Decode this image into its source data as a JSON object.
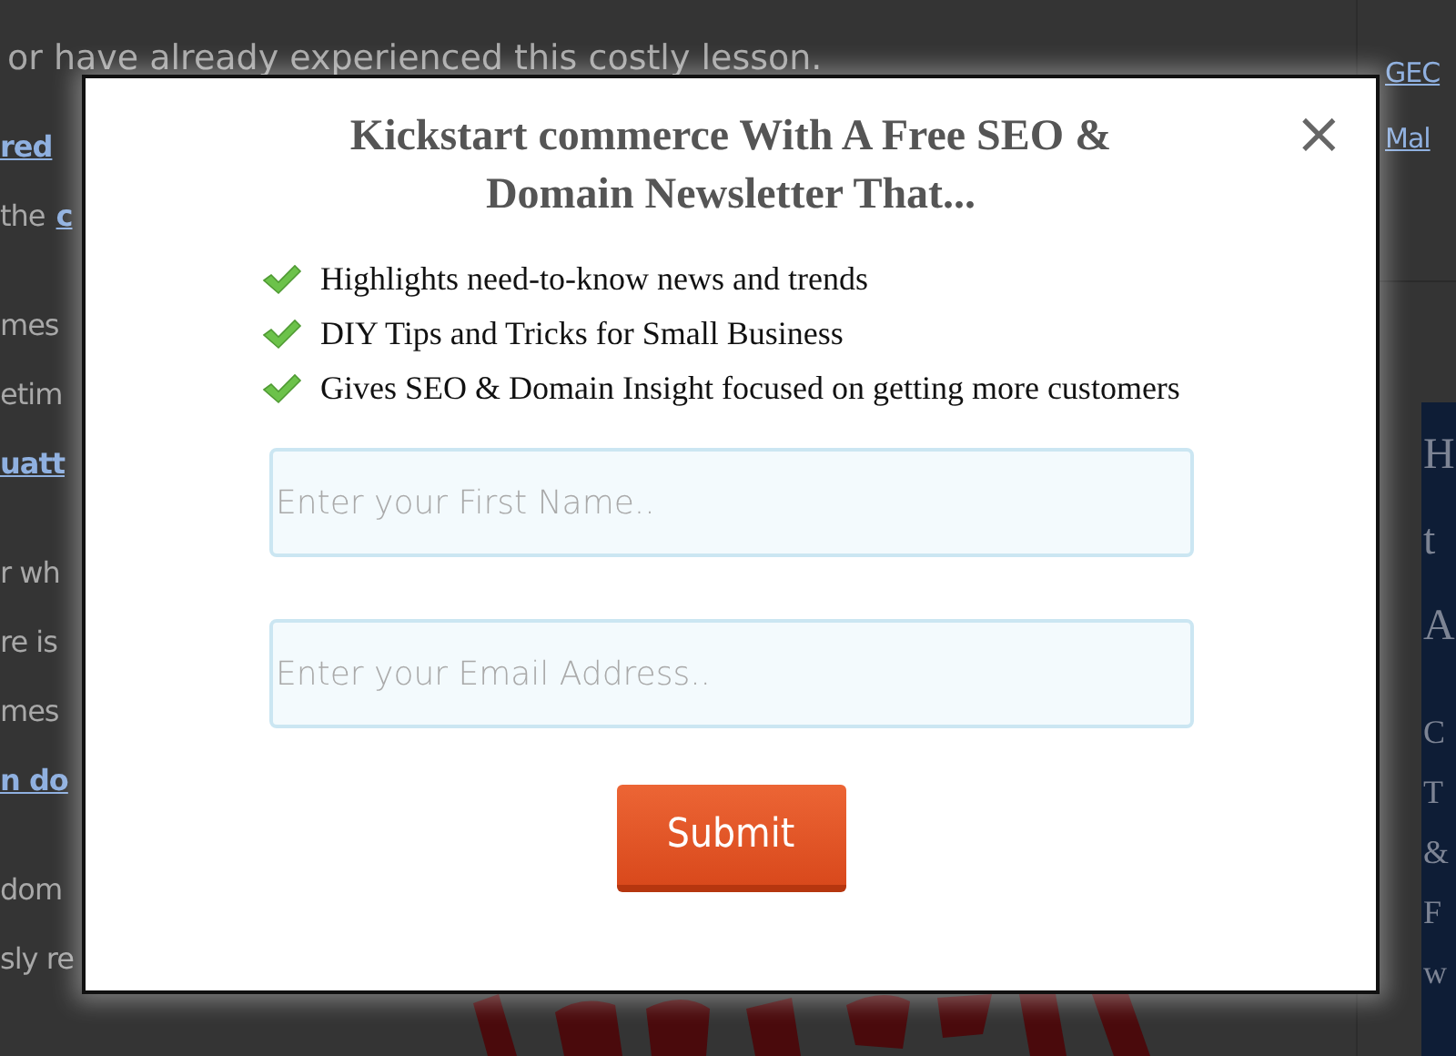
{
  "page": {
    "intro": "or have already experienced this costly lesson.",
    "paragraphs": [
      [
        [
          {
            "text": "red",
            "link": true
          }
        ],
        [
          {
            "text": "the",
            "link": false
          },
          {
            "text": "c",
            "link": true
          }
        ]
      ],
      [
        [
          {
            "text": "mes",
            "link": false
          }
        ],
        [
          {
            "text": "etim",
            "link": false
          }
        ],
        [
          {
            "text": "uatt",
            "link": true
          }
        ]
      ],
      [
        [
          {
            "text": "r wh",
            "link": false
          }
        ],
        [
          {
            "text": "re is",
            "link": false
          }
        ],
        [
          {
            "text": "mes",
            "link": false
          }
        ],
        [
          {
            "text": "n do",
            "link": true
          }
        ]
      ],
      [
        [
          {
            "text": "dom",
            "link": false
          }
        ],
        [
          {
            "text": "sly re",
            "link": false
          }
        ]
      ]
    ],
    "picture": {
      "kind": "picture"
    }
  },
  "sidebar": {
    "links": [
      "GEC",
      "Mal"
    ],
    "banner": {
      "big_letters": [
        "H",
        "t",
        "A"
      ],
      "small_letters": [
        "C",
        "T",
        "&",
        "F",
        "w"
      ]
    }
  },
  "modal": {
    "title": "Kickstart commerce With A Free SEO & Domain Newsletter That...",
    "close": "×",
    "benefits": [
      "Highlights need-to-know news and trends",
      "DIY Tips and Tricks for Small Business",
      "Gives SEO & Domain Insight focused on getting more customers"
    ],
    "fields": [
      {
        "placeholder": "Enter your First Name.."
      },
      {
        "placeholder": "Enter your Email Address.."
      }
    ],
    "submit": "Submit"
  }
}
